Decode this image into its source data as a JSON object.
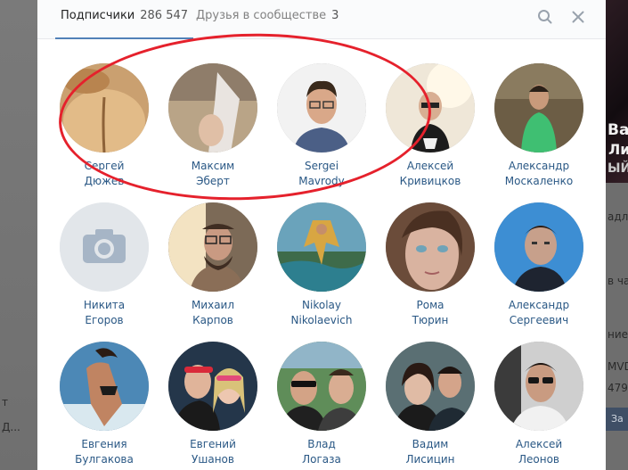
{
  "tabs": [
    {
      "label": "Подписчики",
      "count": "286 547",
      "active": true
    },
    {
      "label": "Друзья в сообществе",
      "count": "3",
      "active": false
    }
  ],
  "icons": {
    "search": "search-icon",
    "close": "close-icon",
    "camera": "camera-icon"
  },
  "colors": {
    "link": "#2a5885",
    "accent": "#5181b8",
    "highlight": "#e5212c"
  },
  "people": [
    {
      "first": "Сергей",
      "last": "Дюжев"
    },
    {
      "first": "Максим",
      "last": "Эберт"
    },
    {
      "first": "Sergei",
      "last": "Mavrody"
    },
    {
      "first": "Алексей",
      "last": "Кривицков"
    },
    {
      "first": "Александр",
      "last": "Москаленко"
    },
    {
      "first": "Никита",
      "last": "Егоров"
    },
    {
      "first": "Михаил",
      "last": "Карпов"
    },
    {
      "first": "Nikolay",
      "last": "Nikolaevich"
    },
    {
      "first": "Рома",
      "last": "Тюрин"
    },
    {
      "first": "Александр",
      "last": "Сергеевич"
    },
    {
      "first": "Евгения",
      "last": "Булгакова"
    },
    {
      "first": "Евгений",
      "last": "Ушанов"
    },
    {
      "first": "Влад",
      "last": "Логаза"
    },
    {
      "first": "Вадим",
      "last": "Лисицин"
    },
    {
      "first": "Алексей",
      "last": "Леонов"
    }
  ],
  "background": {
    "left": [
      "т",
      "Д..."
    ],
    "right": [
      "Ва",
      "Ли",
      "ЫЙ",
      "адл",
      "в ча",
      "ние",
      "MVD",
      "479"
    ],
    "join_label": "За"
  }
}
